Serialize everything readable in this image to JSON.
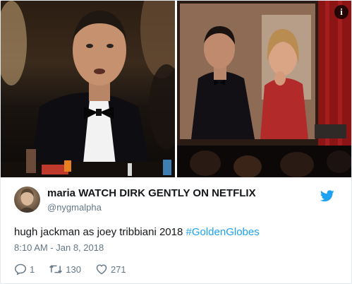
{
  "tweet": {
    "display_name": "maria WATCH DIRK GENTLY ON NETFLIX",
    "username": "@nygmalpha",
    "text": "hugh jackman as joey tribbiani 2018 ",
    "hashtag": "#GoldenGlobes",
    "timestamp": "8:10 AM - Jan 8, 2018",
    "reply_count": "1",
    "retweet_count": "130",
    "like_count": "271"
  },
  "media": {
    "info_glyph": "i"
  },
  "colors": {
    "link": "#1da1f2",
    "text": "#14171a",
    "secondary": "#657786",
    "border": "#e1e8ed"
  },
  "icons": [
    "info-icon",
    "twitter-bird-icon",
    "reply-icon",
    "retweet-icon",
    "heart-icon"
  ]
}
